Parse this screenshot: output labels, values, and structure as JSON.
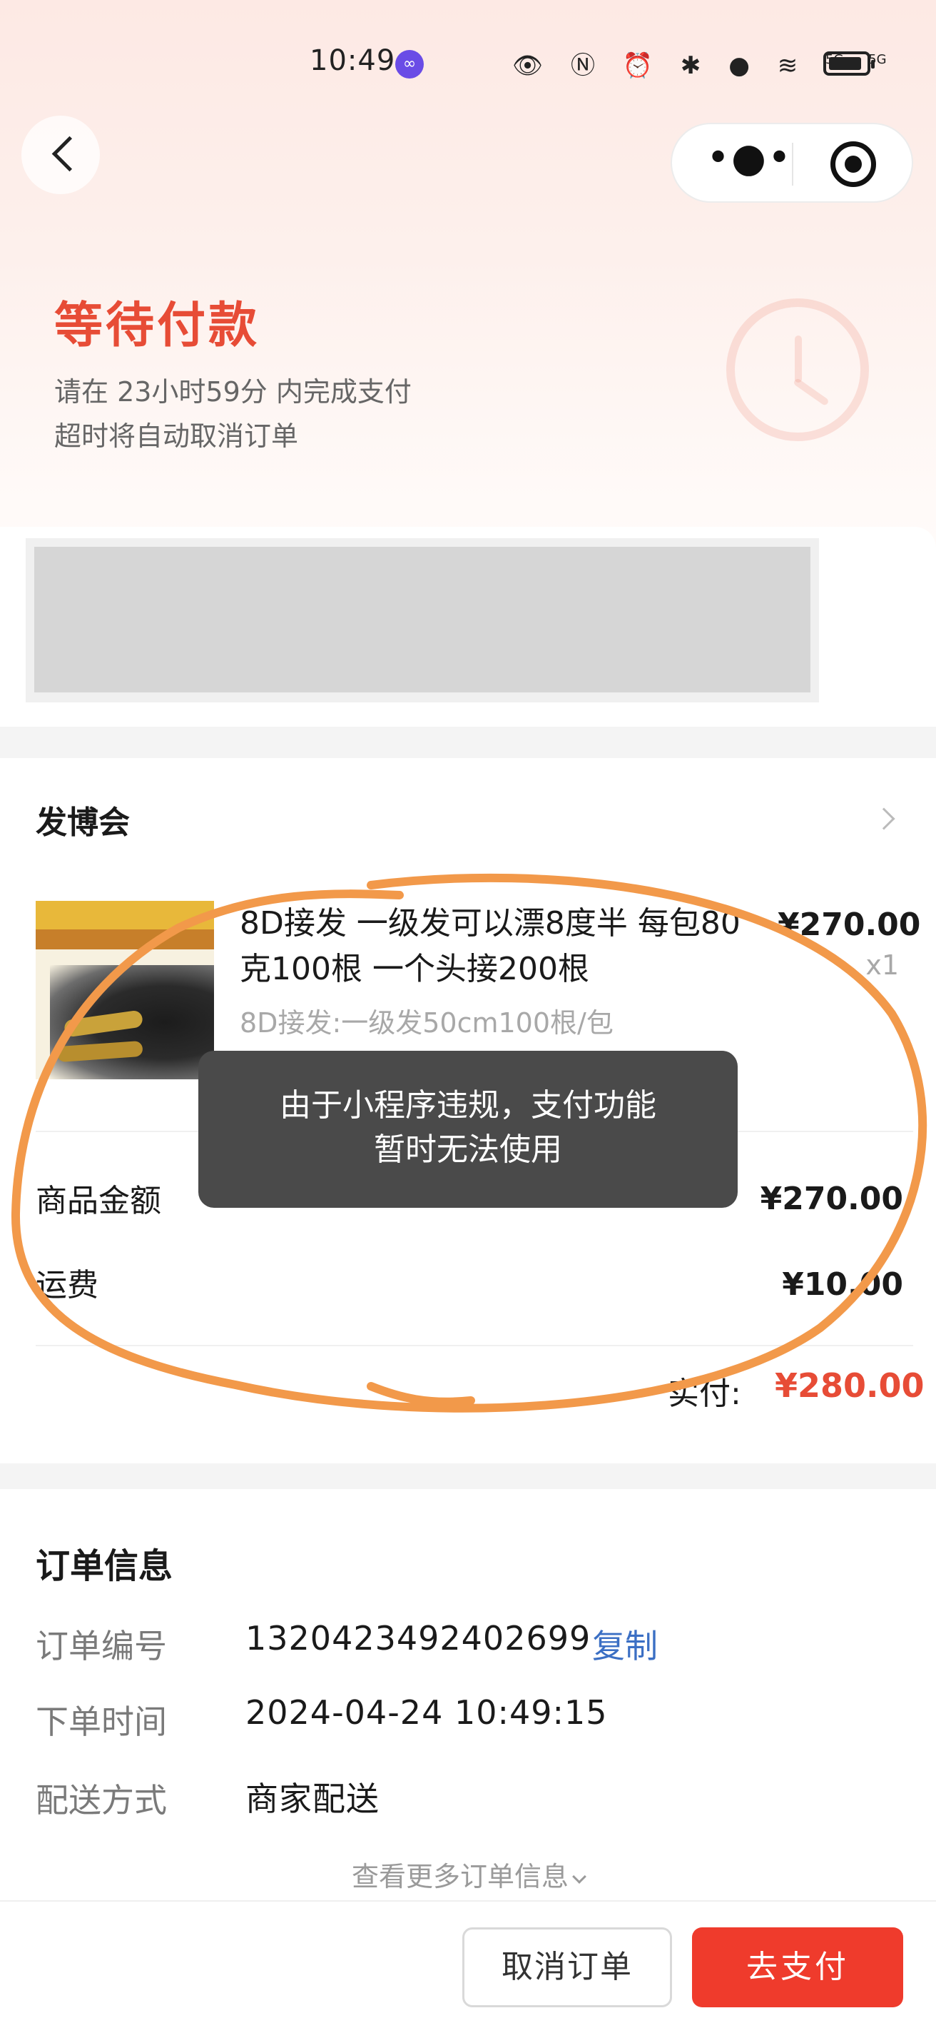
{
  "status_bar": {
    "time": "10:49",
    "time_badge": "∞",
    "icons": "👁 Ⓝ ⏰ ✱ ● ≋",
    "signal_1": "5G",
    "signal_2": "5G",
    "battery_level": 0.9
  },
  "nav": {
    "more_glyph": "•●•"
  },
  "header": {
    "status_title": "等待付款",
    "countdown_text": "请在 23小时59分 内完成支付",
    "auto_cancel_text": "超时将自动取消订单"
  },
  "shop": {
    "name": "发博会"
  },
  "product": {
    "title": "8D接发 一级发可以漂8度半 每包80克100根 一个头接200根",
    "spec": "8D接发:一级发50cm100根/包",
    "price": "¥270.00",
    "quantity": "x1"
  },
  "summary": {
    "goods_label": "商品金额",
    "goods_value": "¥270.00",
    "shipping_label": "运费",
    "shipping_value": "¥10.00",
    "paid_label": "实付:",
    "paid_value": "¥280.00"
  },
  "toast": {
    "line1": "由于小程序违规，支付功能",
    "line2": "暂时无法使用"
  },
  "order_info": {
    "title": "订单信息",
    "rows": [
      {
        "key": "订单编号",
        "value": "1320423492402699"
      },
      {
        "key": "下单时间",
        "value": "2024-04-24 10:49:15"
      },
      {
        "key": "配送方式",
        "value": "商家配送"
      }
    ],
    "copy_label": "复制",
    "more_label": "查看更多订单信息"
  },
  "actions": {
    "cancel_label": "取消订单",
    "pay_label": "去支付"
  },
  "colors": {
    "accent_red": "#e74c36",
    "pay_button": "#ef3b2c",
    "link_blue": "#3b6fc4",
    "annotation_orange": "#f2994a"
  }
}
